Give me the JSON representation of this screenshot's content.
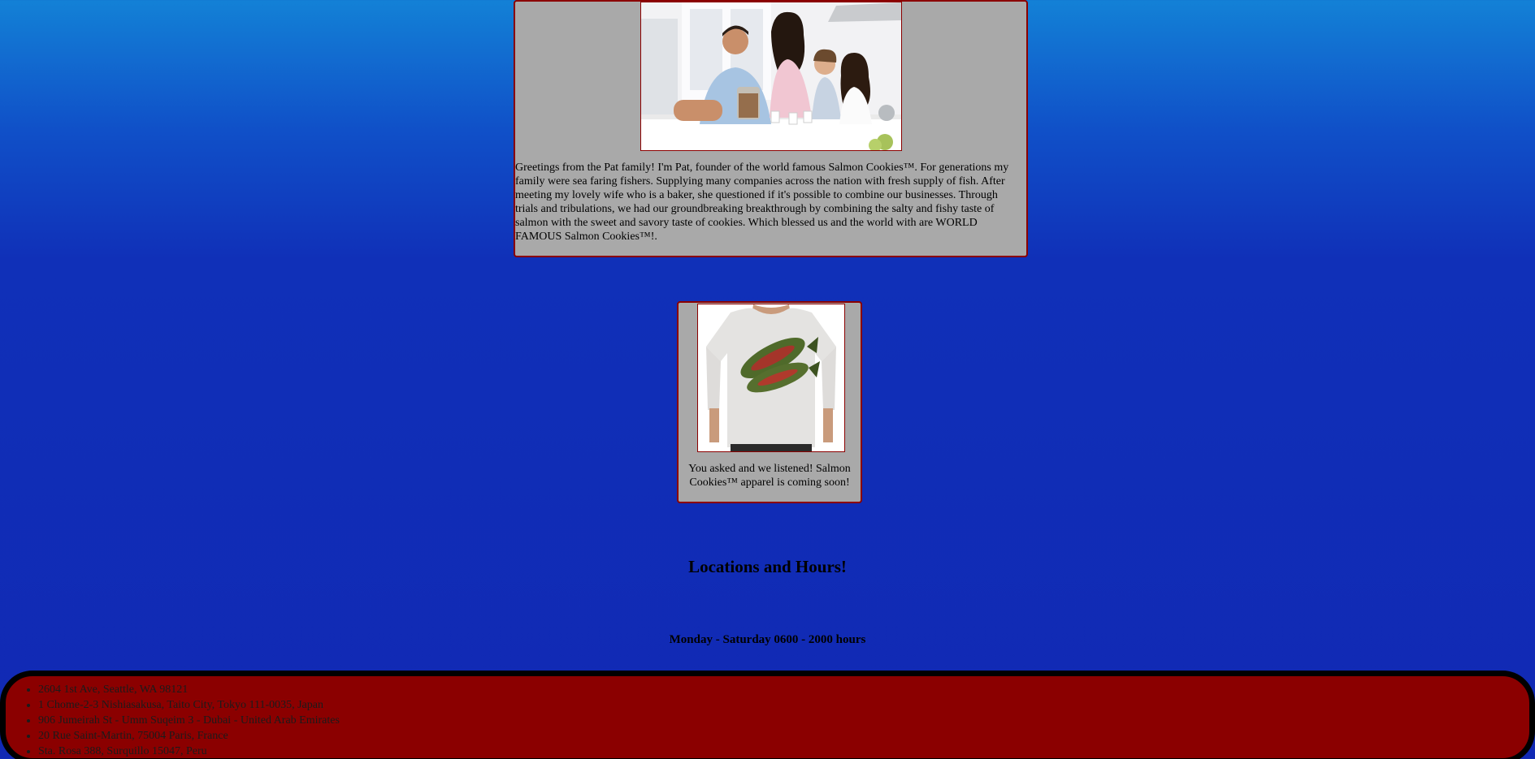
{
  "about": {
    "photo_alt": "family photo",
    "text": "Greetings from the Pat family! I'm Pat, founder of the world famous Salmon Cookies™. For generations my family were sea faring fishers. Supplying many companies across the nation with fresh supply of fish. After meeting my lovely wife who is a baker, she questioned if it's possible to combine our businesses. Through trials and tribulations, we had our groundbreaking breakthrough by combining the salty and fishy taste of salmon with the sweet and savory taste of cookies. Which blessed us and the world with are WORLD FAMOUS Salmon Cookies™!."
  },
  "apparel": {
    "photo_alt": "salmon t-shirt",
    "text": "You asked and we listened! Salmon Cookies™ apparel is coming soon!"
  },
  "locations": {
    "heading": "Locations and Hours!",
    "hours": "Monday - Saturday 0600 - 2000 hours",
    "items": [
      "2604 1st Ave, Seattle, WA 98121",
      "1 Chome-2-3 Nishiasakusa, Taito City, Tokyo 111-0035, Japan",
      "906 Jumeirah St - Umm Suqeim 3 - Dubai - United Arab Emirates",
      "20 Rue Saint-Martin, 75004 Paris, France",
      "Sta. Rosa 388, Surquillo 15047, Peru"
    ]
  },
  "colors": {
    "card_background": "#a9a9a9",
    "card_border": "#8b0000",
    "locations_background": "#8b0000",
    "locations_border": "#000000"
  }
}
